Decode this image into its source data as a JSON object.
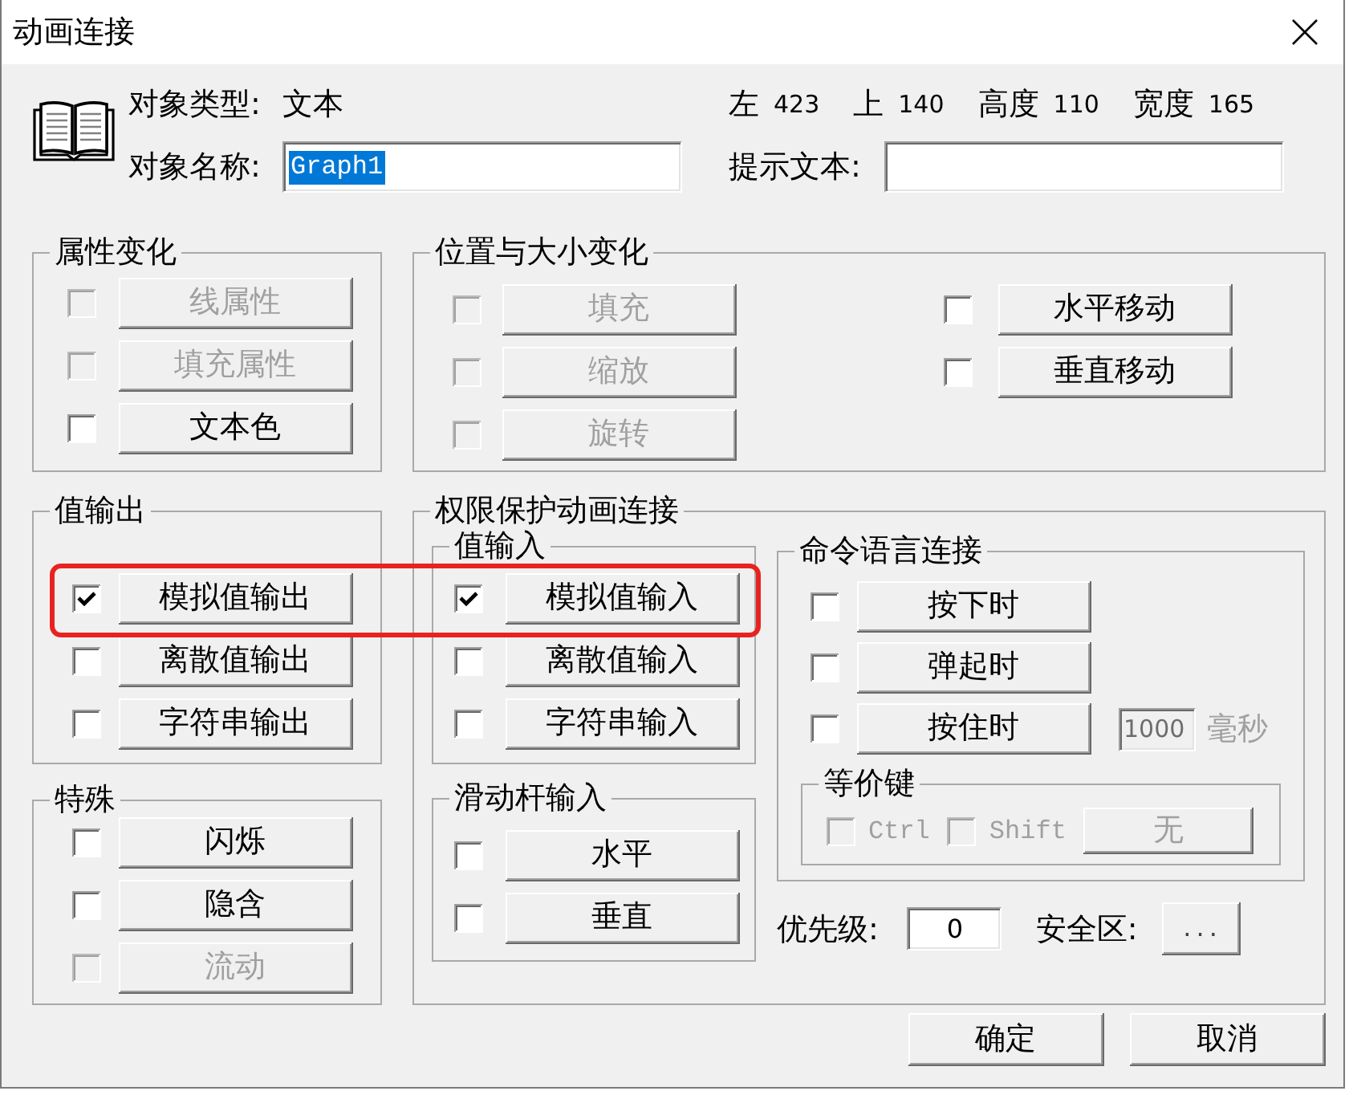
{
  "window": {
    "title": "动画连接"
  },
  "object": {
    "type": {
      "label": "对象类型:",
      "value": "文本"
    },
    "geometry": [
      {
        "label": "左",
        "value": "423"
      },
      {
        "label": "上",
        "value": "140"
      },
      {
        "label": "高度",
        "value": "110"
      },
      {
        "label": "宽度",
        "value": "165"
      }
    ],
    "name": {
      "label": "对象名称:",
      "value": "Graph1",
      "selected": true
    },
    "hint": {
      "label": "提示文本:"
    }
  },
  "attribute_change": {
    "title": "属性变化",
    "options": [
      {
        "label": "线属性",
        "checked": false,
        "disabled": true
      },
      {
        "label": "填充属性",
        "checked": false,
        "disabled": true
      },
      {
        "label": "文本色",
        "checked": false,
        "disabled": false
      }
    ]
  },
  "position_size": {
    "title": "位置与大小变化",
    "columns": [
      {
        "options": [
          {
            "label": "填充",
            "checked": false,
            "disabled": true
          },
          {
            "label": "缩放",
            "checked": false,
            "disabled": true
          },
          {
            "label": "旋转",
            "checked": false,
            "disabled": true
          }
        ]
      },
      {
        "options": [
          {
            "label": "水平移动",
            "checked": false,
            "disabled": false
          },
          {
            "label": "垂直移动",
            "checked": false,
            "disabled": false
          }
        ]
      }
    ]
  },
  "value_output": {
    "title": "值输出",
    "options": [
      {
        "label": "模拟值输出",
        "checked": true,
        "disabled": false
      },
      {
        "label": "离散值输出",
        "checked": false,
        "disabled": false
      },
      {
        "label": "字符串输出",
        "checked": false,
        "disabled": false
      }
    ]
  },
  "special": {
    "title": "特殊",
    "options": [
      {
        "label": "闪烁",
        "checked": false,
        "disabled": false
      },
      {
        "label": "隐含",
        "checked": false,
        "disabled": false
      },
      {
        "label": "流动",
        "checked": false,
        "disabled": true
      }
    ]
  },
  "protected_links": {
    "title": "权限保护动画连接",
    "value_input": {
      "title": "值输入",
      "options": [
        {
          "label": "模拟值输入",
          "checked": true,
          "disabled": false
        },
        {
          "label": "离散值输入",
          "checked": false,
          "disabled": false
        },
        {
          "label": "字符串输入",
          "checked": false,
          "disabled": false
        }
      ]
    },
    "slider_input": {
      "title": "滑动杆输入",
      "options": [
        {
          "label": "水平",
          "checked": false,
          "disabled": false
        },
        {
          "label": "垂直",
          "checked": false,
          "disabled": false
        }
      ]
    },
    "command_links": {
      "title": "命令语言连接",
      "options": [
        {
          "label": "按下时",
          "checked": false,
          "disabled": false
        },
        {
          "label": "弹起时",
          "checked": false,
          "disabled": false
        },
        {
          "label": "按住时",
          "checked": false,
          "disabled": false,
          "interval": {
            "value": "1000",
            "unit": "毫秒",
            "disabled": true
          }
        }
      ],
      "hotkey": {
        "title": "等价键",
        "modifiers": [
          {
            "label": "Ctrl",
            "checked": false,
            "disabled": true
          },
          {
            "label": "Shift",
            "checked": false,
            "disabled": true
          }
        ],
        "key": {
          "label": "无",
          "disabled": true
        }
      }
    },
    "priority": {
      "label": "优先级:",
      "value": "0"
    },
    "security_zone": {
      "label": "安全区:",
      "button": "..."
    }
  },
  "buttons": [
    {
      "label": "确定"
    },
    {
      "label": "取消"
    }
  ],
  "highlight_frame": true
}
